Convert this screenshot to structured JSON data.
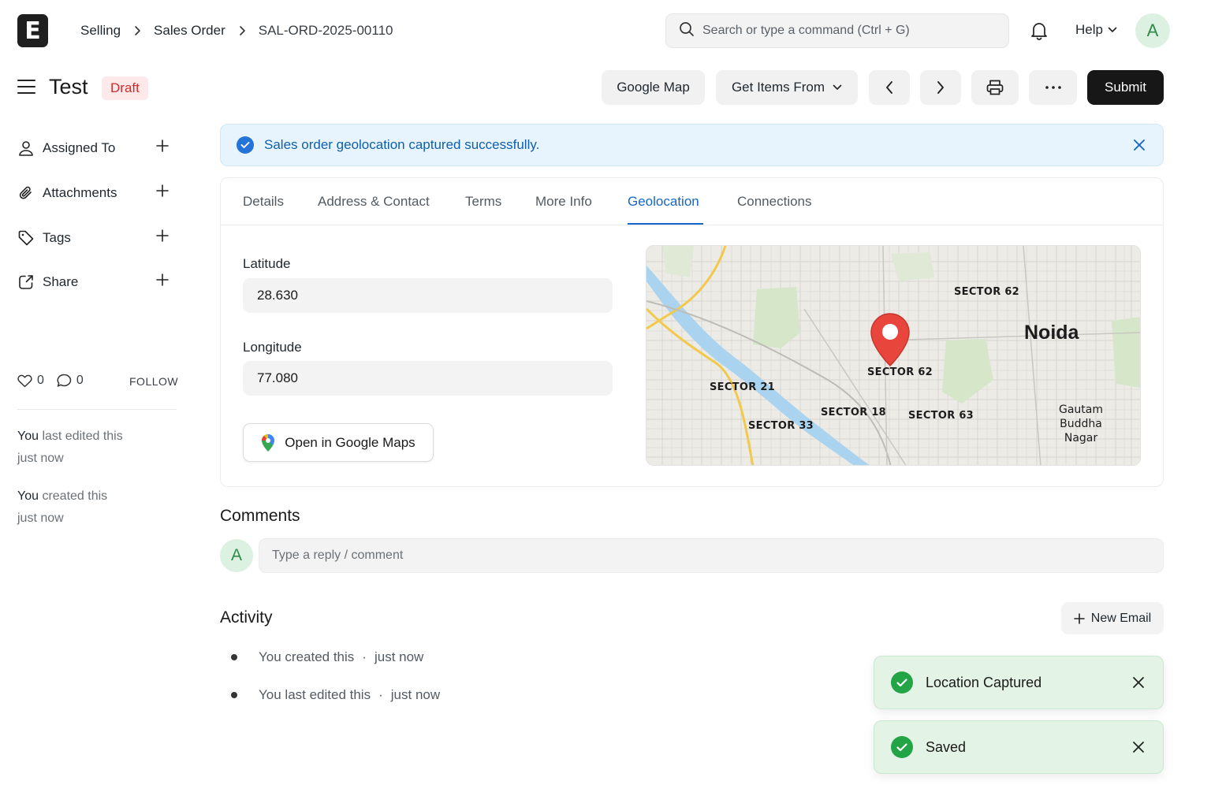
{
  "app": {
    "logo_letter": "E",
    "avatar_letter": "A"
  },
  "breadcrumb": [
    "Selling",
    "Sales Order",
    "SAL-ORD-2025-00110"
  ],
  "search": {
    "placeholder": "Search or type a command (Ctrl + G)"
  },
  "help_label": "Help",
  "title": {
    "text": "Test",
    "status": "Draft"
  },
  "toolbar": {
    "google_map": "Google Map",
    "get_items_from": "Get Items From",
    "submit": "Submit"
  },
  "sidebar": {
    "items": [
      {
        "label": "Assigned To",
        "icon": "user-icon"
      },
      {
        "label": "Attachments",
        "icon": "paperclip-icon"
      },
      {
        "label": "Tags",
        "icon": "tag-icon"
      },
      {
        "label": "Share",
        "icon": "share-icon"
      }
    ],
    "likes": "0",
    "comments": "0",
    "follow": "FOLLOW",
    "last_edited": {
      "who": "You",
      "text": "last edited this",
      "when": "just now"
    },
    "created": {
      "who": "You",
      "text": "created this",
      "when": "just now"
    }
  },
  "alert": {
    "message": "Sales order geolocation captured successfully.",
    "color": "#2473d9"
  },
  "tabs": [
    "Details",
    "Address & Contact",
    "Terms",
    "More Info",
    "Geolocation",
    "Connections"
  ],
  "active_tab": "Geolocation",
  "geolocation": {
    "latitude_label": "Latitude",
    "latitude": "28.630",
    "longitude_label": "Longitude",
    "longitude": "77.080",
    "open_maps": "Open in Google Maps"
  },
  "map": {
    "city": "Noida",
    "district": [
      "Gautam Buddha",
      "Nagar"
    ],
    "sectors": [
      "SECTOR 62",
      "SECTOR 62",
      "SECTOR 21",
      "SECTOR 18",
      "SECTOR 63",
      "SECTOR 33"
    ]
  },
  "comments": {
    "title": "Comments",
    "placeholder": "Type a reply / comment"
  },
  "activity": {
    "title": "Activity",
    "new_email": "New Email",
    "items": [
      {
        "text": "You created this",
        "when": "just now"
      },
      {
        "text": "You last edited this",
        "when": "just now"
      }
    ]
  },
  "toasts": [
    {
      "message": "Location Captured",
      "color": "#22a447"
    },
    {
      "message": "Saved",
      "color": "#22a447"
    }
  ]
}
